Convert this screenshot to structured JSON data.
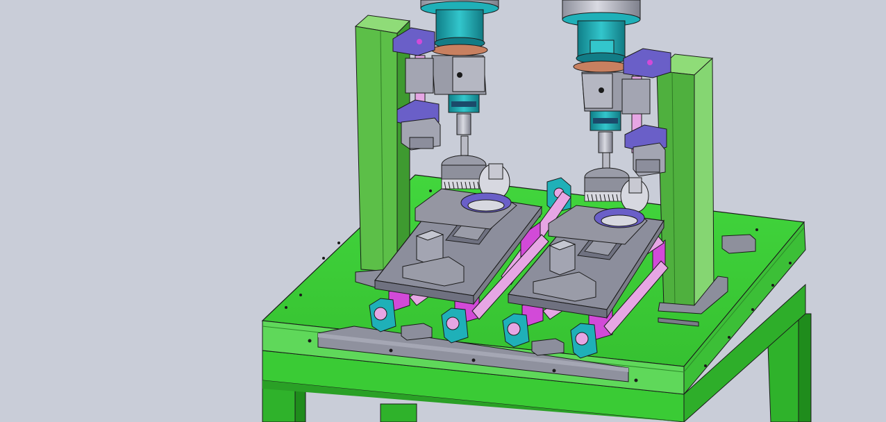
{
  "viewport": {
    "background": "#c9cdd8"
  },
  "colors": {
    "table_green": "#3fd03a",
    "table_green_dark": "#1f9a1b",
    "table_green_light": "#7fe66f",
    "column_green": "#5fbf4c",
    "column_green_light": "#8fdc78",
    "plate_gray": "#8c8e9c",
    "plate_gray_dark": "#6f7180",
    "teal": "#1fb0b8",
    "teal_dark": "#127c86",
    "magenta": "#d24ad8",
    "pink_rod": "#e6a6e4",
    "purple_block": "#6a5fc8",
    "spindle_gray": "#b9bac4"
  }
}
